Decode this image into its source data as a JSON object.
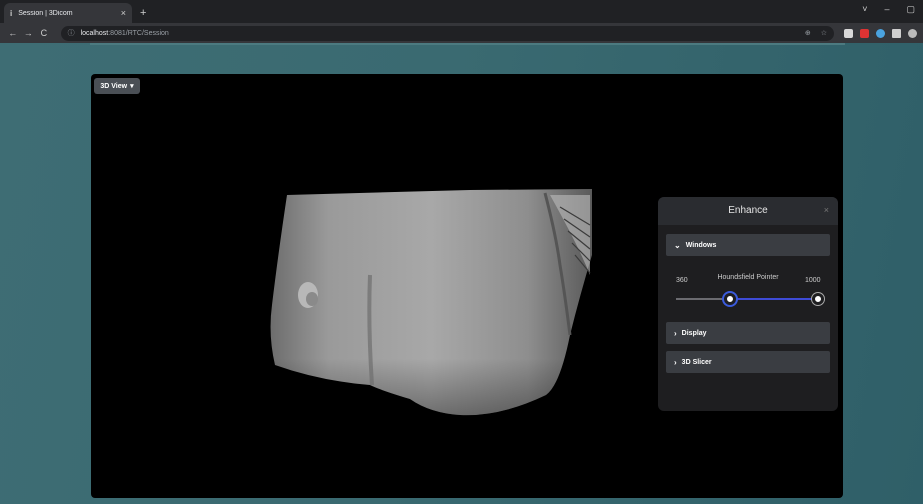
{
  "browser": {
    "tab_title": "Session | 3Dicom",
    "tab_close": "×",
    "new_tab": "+",
    "url_host": "localhost",
    "url_rest": ":8081/RTC/Session",
    "win_controls": [
      "˅",
      "–",
      "▢"
    ]
  },
  "viewer": {
    "view_dropdown_label": "3D View"
  },
  "enhance": {
    "title": "Enhance",
    "close": "×",
    "sections": {
      "windows": "Windows",
      "display": "Display",
      "slicer": "3D Slicer"
    },
    "houndsfield": {
      "label": "Houndsfield Pointer",
      "min_label": "360",
      "max_label": "1000",
      "low_fraction": 0.38,
      "high_fraction": 1.0
    }
  },
  "colors": {
    "page_bg": "#3a6a71",
    "slider_fill": "#3e4bd6",
    "panel_bg": "#1e1e20"
  }
}
